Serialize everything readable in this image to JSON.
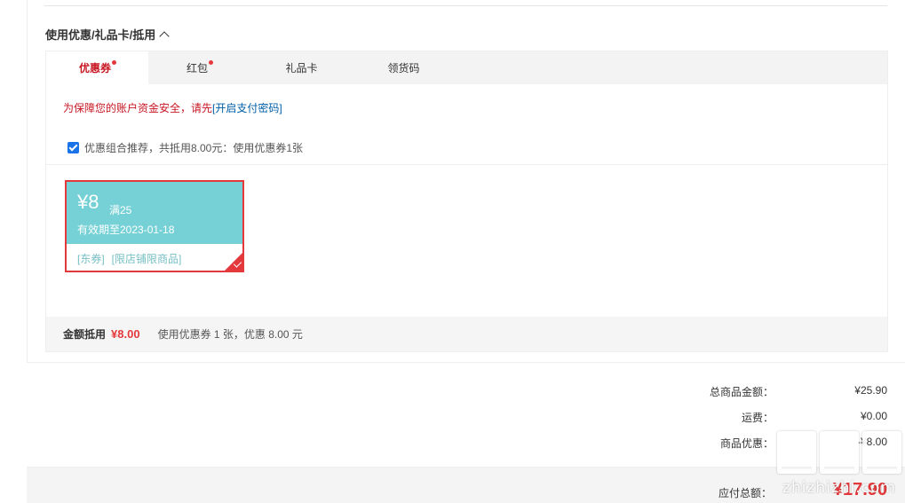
{
  "section": {
    "title": "使用优惠/礼品卡/抵用"
  },
  "tabs": [
    {
      "label": "优惠券",
      "active": true,
      "dot": true
    },
    {
      "label": "红包",
      "active": false,
      "dot": true
    },
    {
      "label": "礼品卡",
      "active": false,
      "dot": false
    },
    {
      "label": "领货码",
      "active": false,
      "dot": false
    }
  ],
  "security": {
    "note": "为保障您的账户资金安全，请先",
    "link": "[开启支付密码]"
  },
  "combo": {
    "checked": true,
    "text": "优惠组合推荐，共抵用8.00元：使用优惠券1张"
  },
  "coupon": {
    "amount": "¥8",
    "condition": "满25",
    "validity": "有效期至2023-01-18",
    "tag_type": "[东券]",
    "tag_scope": "[限店铺限商品]",
    "selected": true
  },
  "summary": {
    "label": "金额抵用",
    "amount": "¥8.00",
    "desc": "使用优惠券 1 张，优惠 8.00 元"
  },
  "totals": {
    "goods_label": "总商品金额：",
    "goods_value": "¥25.90",
    "shipping_label": "运费：",
    "shipping_value": "¥0.00",
    "discount_label": "商品优惠：",
    "discount_value": "-¥8.00"
  },
  "payment": {
    "label": "应付总额：",
    "amount": "¥17.90"
  },
  "watermark": {
    "text": "zhizhizhi.com"
  },
  "colors": {
    "accent_red": "#e4393c",
    "coupon_teal": "#76d1d6",
    "link_blue": "#005ea7"
  }
}
